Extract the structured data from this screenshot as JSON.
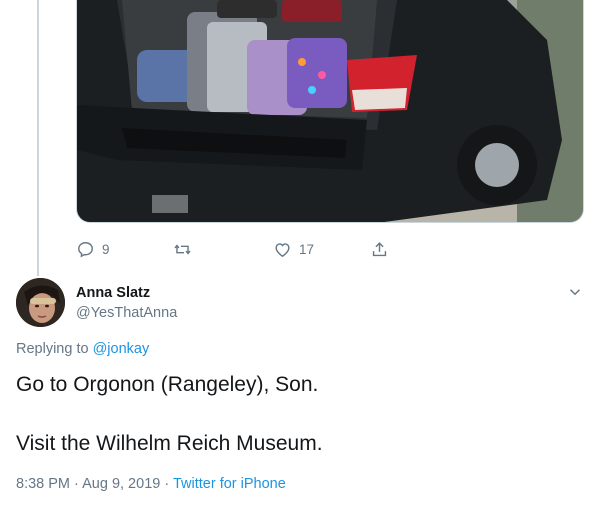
{
  "parent_tweet": {
    "photo_alt": "Minivan trunk packed with suitcases",
    "actions": {
      "reply_count": "9",
      "retweet_count": "",
      "like_count": "17"
    }
  },
  "reply": {
    "author_name": "Anna Slatz",
    "author_handle": "@YesThatAnna",
    "replying_prefix": "Replying to",
    "replying_to": "@jonkay",
    "text_line_1": "Go to Orgonon (Rangeley), Son.",
    "text_line_2": "Visit the Wilhelm Reich Museum.",
    "time": "8:38 PM",
    "separator": "·",
    "date": "Aug 9, 2019",
    "source": "Twitter for iPhone"
  },
  "colors": {
    "link": "#1b95e0",
    "secondary_text": "#657786",
    "primary_text": "#14171a",
    "border": "#ccd6dd"
  },
  "icons": [
    "reply-icon",
    "retweet-icon",
    "like-icon",
    "share-icon",
    "chevron-down-icon"
  ]
}
